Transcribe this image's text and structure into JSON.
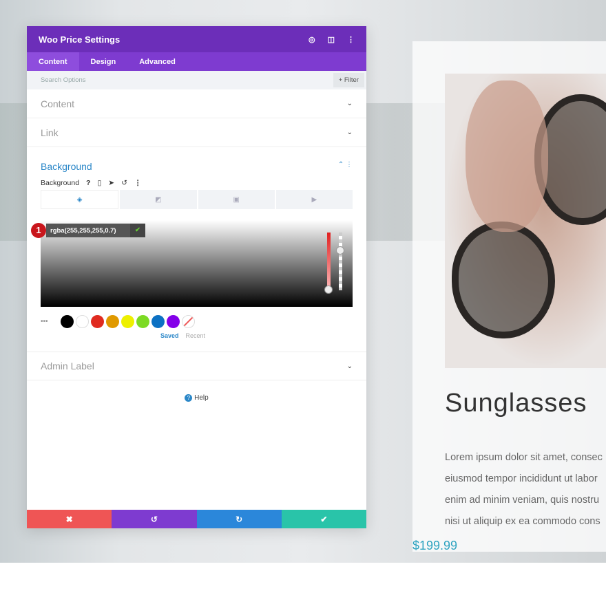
{
  "panel": {
    "title": "Woo Price Settings",
    "tabs": [
      "Content",
      "Design",
      "Advanced"
    ],
    "search_placeholder": "Search Options",
    "filter": "+ Filter",
    "sections": {
      "content": "Content",
      "link": "Link",
      "background": "Background",
      "admin_label": "Admin Label"
    },
    "bg_label": "Background",
    "color_value": "rgba(255,255,255,0.7)",
    "step_badge": "1",
    "swatches": [
      "#000000",
      "#ffffff",
      "#e02b20",
      "#e09900",
      "#edf000",
      "#7cda24",
      "#0c71c3",
      "#8300e9"
    ],
    "swatch_tabs": {
      "saved": "Saved",
      "recent": "Recent"
    },
    "help": "Help",
    "footer_colors": {
      "cancel": "#ef5555",
      "undo": "#7e3bd0",
      "redo": "#2b87da",
      "save": "#29c4a9"
    }
  },
  "product": {
    "title": "Sunglasses",
    "description": [
      "Lorem ipsum dolor sit amet, consec",
      "eiusmod tempor incididunt ut labor",
      "enim ad minim veniam, quis nostru",
      "nisi ut aliquip ex ea commodo cons"
    ],
    "price": "$199.99"
  }
}
